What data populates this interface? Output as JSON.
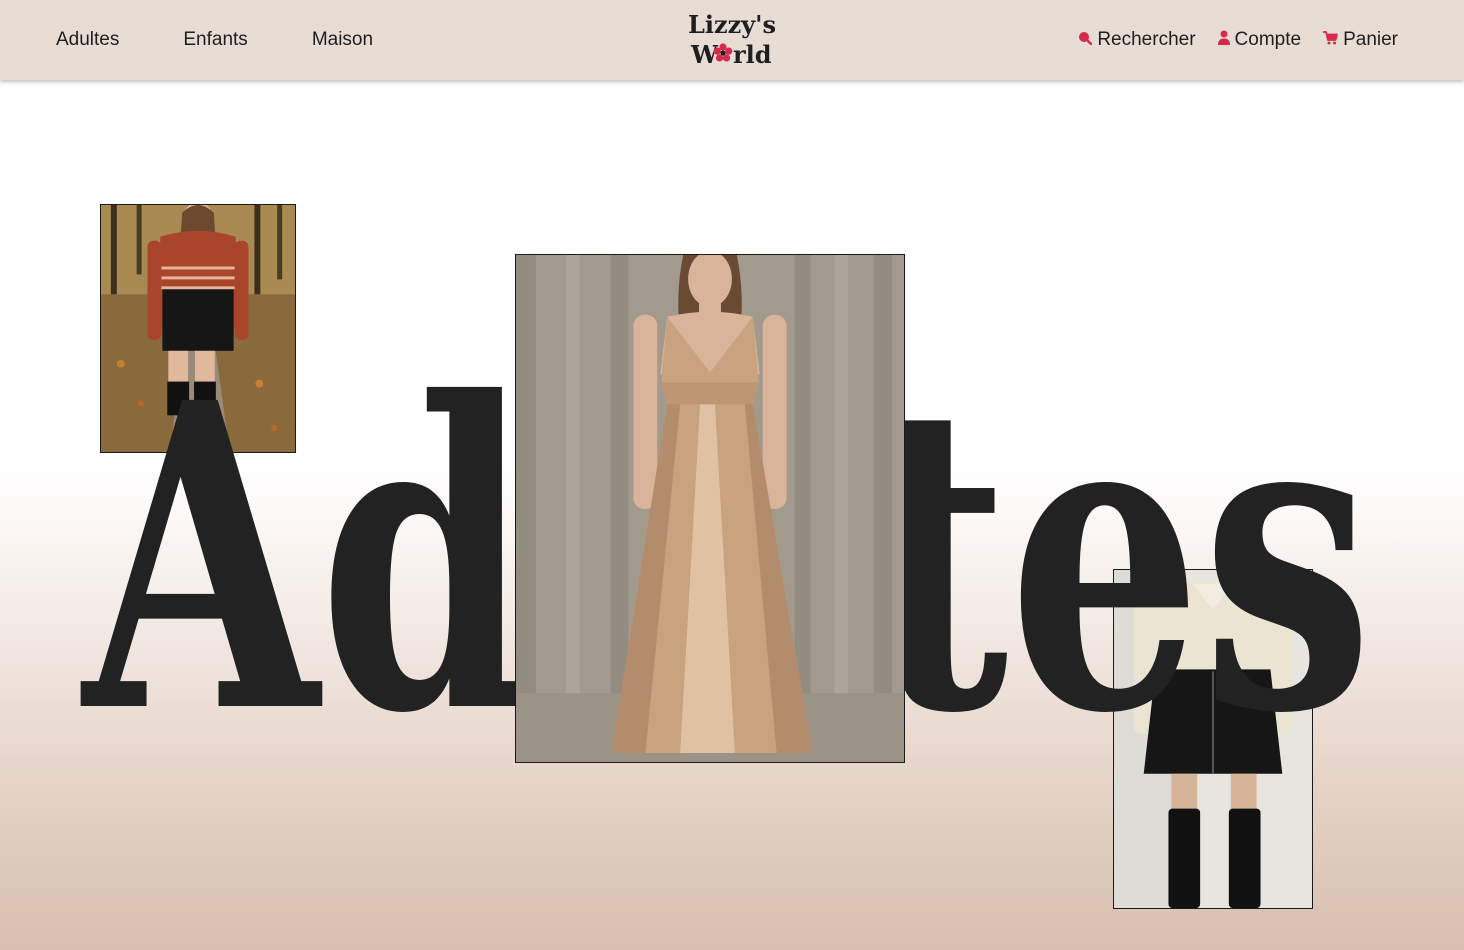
{
  "header": {
    "nav_left": [
      "Adultes",
      "Enfants",
      "Maison"
    ],
    "logo": {
      "line1": "Lizzy's",
      "line2_a": "W",
      "line2_b": "rld"
    },
    "nav_right": {
      "search_label": "Rechercher",
      "account_label": "Compte",
      "cart_label": "Panier"
    }
  },
  "hero": {
    "title": "Adultes"
  },
  "colors": {
    "accent": "#d6294b",
    "header_bg": "#e8ddd4",
    "text_dark": "#222222"
  },
  "icons": [
    "search-icon",
    "user-icon",
    "cart-icon",
    "flower-icon"
  ]
}
